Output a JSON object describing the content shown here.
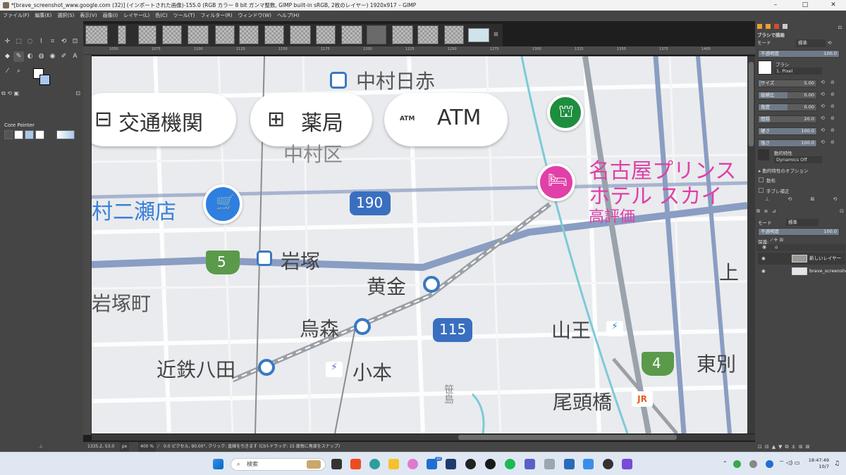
{
  "window": {
    "title": "*[brave_screenshot_www.google.com (32)] (インポートされた画像)-155.0 (RGB カラー 8 bit ガンマ整数, GIMP built-in sRGB, 2枚のレイヤー) 1920x917 – GIMP",
    "minimize": "–",
    "maximize": "□",
    "close": "✕"
  },
  "menu": [
    "ファイル(F)",
    "編集(E)",
    "選択(S)",
    "表示(V)",
    "画像(I)",
    "レイヤー(L)",
    "色(C)",
    "ツール(T)",
    "フィルター(R)",
    "ウィンドウ(W)",
    "ヘルプ(H)"
  ],
  "toolbox": {
    "tool_options_title": "Core Pointer",
    "fg_color": "#ffffff",
    "bg_color": "#a8c8ec"
  },
  "image_tabs": {
    "close": "⊠"
  },
  "ruler": {
    "labels": [
      "1050",
      "1075",
      "1100",
      "1125",
      "1150",
      "1175",
      "1200",
      "1225",
      "1250",
      "1275",
      "1300",
      "1325",
      "1350",
      "1375",
      "1400"
    ]
  },
  "map": {
    "chips": [
      {
        "icon": "bus-icon",
        "label": "交通機関"
      },
      {
        "icon": "pharmacy-icon",
        "label": "薬局"
      },
      {
        "icon": "atm-icon",
        "label": "ATM",
        "icon_text": "ATM"
      }
    ],
    "labels": {
      "nakamura_nisseki": "中村日赤",
      "nakamura_ku": "中村区",
      "store": "村二瀬店",
      "route190": "190",
      "route5": "5",
      "iwatsuka": "岩塚",
      "kogane": "黄金",
      "iwatsuka_cho": "岩塚町",
      "karasumori": "烏森",
      "route115": "115",
      "kintetsu_hatta": "近鉄八田",
      "komoto": "小本",
      "hotel_1": "名古屋プリンス",
      "hotel_2": "ホテル スカイ",
      "hotel_3": "高評価",
      "sanno": "山王",
      "route4": "4",
      "higashi": "東別",
      "ue": "上",
      "obashi": "尾頭橋",
      "jr": "JR",
      "shrine": "笹島"
    }
  },
  "status": {
    "coords": "1335.2, 53.0",
    "unit": "px",
    "zoom": "400 %",
    "message": "0.0 ピクセル, 90.00°, クリック: 直線を引きます (Ctrl-ドラッグ: 15 度毎に角度をスナップ)"
  },
  "brush_panel": {
    "title": "ブラシで描画",
    "mode_label": "モード",
    "mode_value": "標準",
    "opacity_label": "不透明度",
    "opacity": "100.0",
    "brush_label": "ブラシ",
    "brush_name": "1. Pixel",
    "sliders": [
      {
        "label": "サイズ",
        "value": "5.00",
        "fraction": 0.05
      },
      {
        "label": "縦横比",
        "value": "0.00",
        "fraction": 0.5
      },
      {
        "label": "角度",
        "value": "0.00",
        "fraction": 0.5
      },
      {
        "label": "間隔",
        "value": "20.0",
        "fraction": 0.2
      },
      {
        "label": "硬さ",
        "value": "100.0",
        "fraction": 1.0
      },
      {
        "label": "強さ",
        "value": "100.0",
        "fraction": 1.0
      }
    ],
    "dynamics_label": "動的特性",
    "dynamics_value": "Dynamics Off",
    "dyn_options": "動的特性のオプション",
    "scatter": "散布",
    "smooth": "手ブレ補正"
  },
  "layers_panel": {
    "mode_label": "モード",
    "mode_value": "標準",
    "opacity_label": "不透明度",
    "opacity": "100.0",
    "lock_label": "保護:",
    "layers": [
      {
        "name": "新しいレイヤー"
      },
      {
        "name": "brave_screenshot"
      }
    ]
  },
  "taskbar": {
    "search": "検索",
    "badge": "22",
    "time": "18:47:49",
    "date": "10/7"
  }
}
